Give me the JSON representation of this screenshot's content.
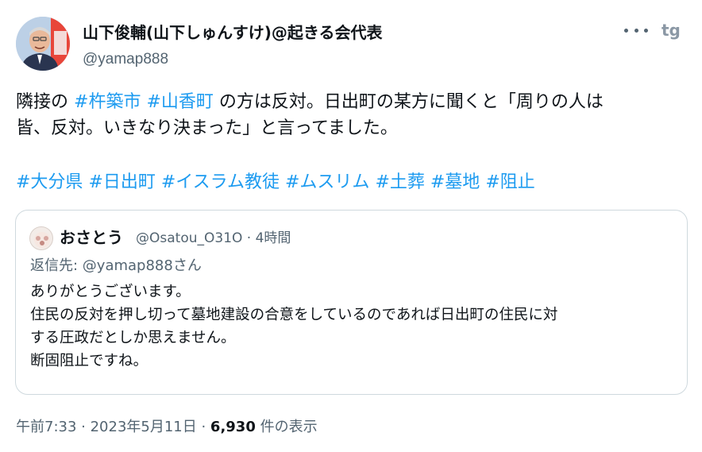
{
  "author": {
    "display_name": "山下俊輔(山下しゅんすけ)@起きる会代表",
    "handle": "@yamap888"
  },
  "tweet": {
    "line1_pre": "隣接の",
    "line1_tag1": "#杵築市",
    "line1_tag2": "#山香町",
    "line1_post": "の方は反対。日出町の某方に聞くと「周りの人は",
    "line2": "皆、反対。いきなり決まった」と言ってました。",
    "hashtags": [
      "#大分県",
      "#日出町",
      "#イスラム教徒",
      "#ムスリム",
      "#土葬",
      "#墓地",
      "#阻止"
    ]
  },
  "quote": {
    "name": "おさとう",
    "meta": "@Osatou_O31O · 4時間",
    "reply_prefix": "返信先: ",
    "reply_handle": "@yamap888",
    "reply_suffix": "さん",
    "lines": [
      "ありがとうございます。",
      "住民の反対を押し切って墓地建設の合意をしているのであれば日出町の住民に対",
      "する圧政だとしか思えません。",
      "断固阻止ですね。"
    ]
  },
  "footer": {
    "time_date": "午前7:33 · 2023年5月11日 · ",
    "views": "6,930",
    "views_suffix": " 件の表示"
  },
  "colors": {
    "link": "#1d9bf0",
    "text": "#0f1419",
    "muted": "#536471",
    "border": "#cfd9de"
  }
}
